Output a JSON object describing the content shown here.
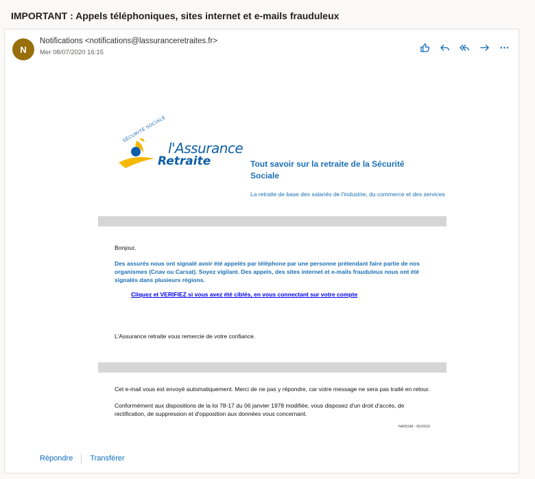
{
  "subject": "IMPORTANT : Appels téléphoniques, sites internet et e-mails frauduleux",
  "message": {
    "avatar_initial": "N",
    "sender": "Notifications <notifications@lassuranceretraites.fr>",
    "date": "Mer 08/07/2020 16:15",
    "action_icons": [
      "like-icon",
      "reply-icon",
      "reply-all-icon",
      "forward-icon",
      "more-icon"
    ]
  },
  "email": {
    "logo": {
      "arc": "SÉCURITÉ SOCIALE",
      "line1": "l'Assurance",
      "line2": "Retraite"
    },
    "tagline_title": "Tout savoir sur la retraite de la Sécurité Sociale",
    "tagline_sub": "La retraite de base des salariés de l'industrie, du commerce et des services",
    "greeting": "Bonjour,",
    "alert": "Des assurés nous ont signalé avoir été appelés par téléphone par une personne prétendant faire partie de nos organismes (Cnav ou Carsat). Soyez vigilant. Des appels, des sites internet et e-mails frauduleux nous ont été signalés dans plusieurs régions.",
    "link": "Cliquez et VERIFIEZ si vous avez été ciblés, en vous connectant sur votre compte",
    "thanks": "L'Assurance retraite vous remercie de votre confiance.",
    "footer1": "Cet e-mail vous est envoyé automatiquement. Merci de ne pas y répondre, car votre message ne sera pas traité en retour.",
    "footer2": "Conformément aux dispositions de la loi 78-17 du 06 janvier 1978 modifiée, vous disposez d'un droit d'accès, de rectification, de suppression et d'opposition aux données vous concernant.",
    "ref": "N405SM - 05/2019"
  },
  "footer": {
    "reply": "Répondre",
    "forward": "Transférer"
  },
  "colors": {
    "accent": "#0f6cbd",
    "brand_blue": "#1a6fb5",
    "avatar": "#986f0b",
    "logo_yellow": "#f5b800"
  }
}
